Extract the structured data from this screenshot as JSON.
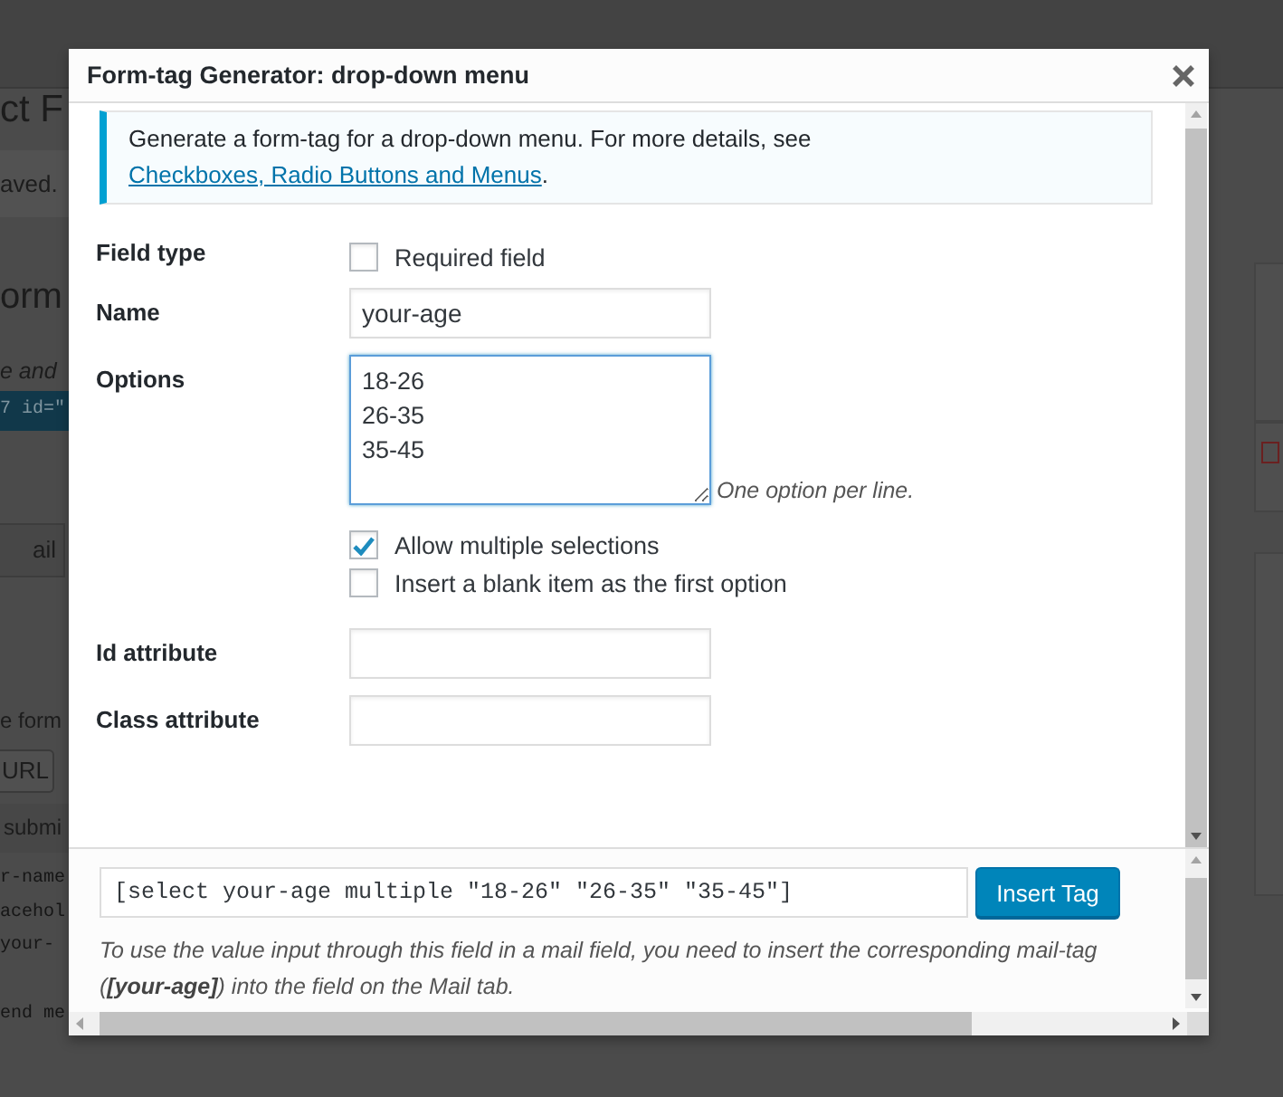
{
  "background": {
    "fragments": [
      {
        "kind": "heading",
        "text": "ct F"
      },
      {
        "kind": "notice",
        "text": "aved."
      },
      {
        "kind": "subheading",
        "text": "orm"
      },
      {
        "kind": "italic",
        "text": "e and"
      },
      {
        "kind": "code-band",
        "text": "7 id=\""
      },
      {
        "kind": "tab",
        "text": "ail"
      },
      {
        "kind": "text",
        "text": "e form"
      },
      {
        "kind": "button",
        "text": "URL"
      },
      {
        "kind": "bar",
        "text": "submi"
      },
      {
        "kind": "code",
        "text": "r-name"
      },
      {
        "kind": "code",
        "text": "acehol"
      },
      {
        "kind": "code",
        "text": "your-"
      },
      {
        "kind": "code",
        "text": "end me"
      }
    ]
  },
  "dialog": {
    "title": "Form-tag Generator: drop-down menu",
    "notice": {
      "text": "Generate a form-tag for a drop-down menu. For more details, see ",
      "link": "Checkboxes, Radio Buttons and Menus",
      "after": "."
    },
    "rows": [
      {
        "label": "Field type",
        "kind": "checkboxes",
        "options": [
          {
            "label": "Required field",
            "checked": false
          }
        ]
      },
      {
        "label": "Name",
        "kind": "text",
        "value": "your-age"
      },
      {
        "label": "Options",
        "kind": "textarea",
        "focused": true,
        "lines": [
          "18-26",
          "26-35",
          "35-45"
        ],
        "hint": "One option per line.",
        "options": [
          {
            "label": "Allow multiple selections",
            "checked": true
          },
          {
            "label": "Insert a blank item as the first option",
            "checked": false
          }
        ]
      },
      {
        "label": "Id attribute",
        "kind": "text"
      },
      {
        "label": "Class attribute",
        "kind": "text"
      }
    ],
    "footer": {
      "tag": "[select your-age multiple \"18-26\" \"26-35\" \"35-45\"]",
      "button": "Insert Tag",
      "note": "To use the value input through this field in a mail field, you need to insert the corresponding mail-tag (**[your-age]**) into the field on the Mail tab."
    }
  }
}
